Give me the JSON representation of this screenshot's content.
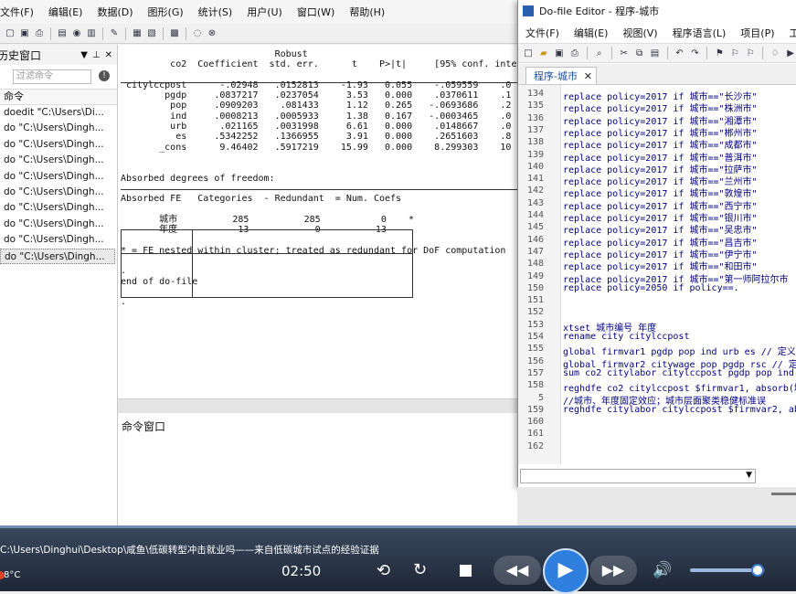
{
  "stata": {
    "menu": [
      "文件(F)",
      "编辑(E)",
      "数据(D)",
      "图形(G)",
      "统计(S)",
      "用户(U)",
      "窗口(W)",
      "帮助(H)"
    ],
    "history": {
      "title": "历史窗口",
      "filter_placeholder": "过滤命令",
      "column": "命令",
      "items": [
        "doedit \"C:\\Users\\Di...",
        "do \"C:\\Users\\Dingh...",
        "do \"C:\\Users\\Dingh...",
        "do \"C:\\Users\\Dingh...",
        "do \"C:\\Users\\Dingh...",
        "do \"C:\\Users\\Dingh...",
        "do \"C:\\Users\\Dingh...",
        "do \"C:\\Users\\Dingh...",
        "do \"C:\\Users\\Dingh...",
        "do \"C:\\Users\\Dingh..."
      ]
    },
    "results_text": "                            Robust\n         co2  Coefficient  std. err.      t    P>|t|     [95% conf. inte\n\n citylccpost      -.02948   .0152813    -1.93   0.055    -.059559    .0\n        pgdp     .0837217   .0237054     3.53   0.000    .0370611    .1\n         pop     .0909203    .081433     1.12   0.265   -.0693686    .2\n         ind     .0008213   .0005933     1.38   0.167   -.0003465    .0\n         urb      .021165   .0031998     6.61   0.000    .0148667    .0\n          es     .5342252   .1366955     3.91   0.000    .2651603    .8\n       _cons      9.46402   .5917219    15.99   0.000    8.299303    10\n\n\nAbsorbed degrees of freedom:\n\nAbsorbed FE   Categories  - Redundant  = Num. Coefs\n\n       城市          285          285           0    *\n       年度           13            0          13\n\n* = FE nested within cluster; treated as redundant for DoF computation\n\n.\nend of do-file\n\n.",
    "command_window": "命令窗口"
  },
  "editor": {
    "title": "Do-file Editor - 程序-城市",
    "menu": [
      "文件(F)",
      "编辑(E)",
      "视图(V)",
      "程序语言(L)",
      "项目(P)",
      "工具(T)"
    ],
    "tab": "程序-城市",
    "lines": [
      {
        "n": "134",
        "t": "replace policy=2017 if 城市==\"长沙市\""
      },
      {
        "n": "135",
        "t": "replace policy=2017 if 城市==\"株洲市\""
      },
      {
        "n": "136",
        "t": "replace policy=2017 if 城市==\"湘潭市\""
      },
      {
        "n": "137",
        "t": "replace policy=2017 if 城市==\"郴州市\""
      },
      {
        "n": "138",
        "t": "replace policy=2017 if 城市==\"成都市\""
      },
      {
        "n": "139",
        "t": "replace policy=2017 if 城市==\"普洱市\""
      },
      {
        "n": "140",
        "t": "replace policy=2017 if 城市==\"拉萨市\""
      },
      {
        "n": "141",
        "t": "replace policy=2017 if 城市==\"兰州市\""
      },
      {
        "n": "142",
        "t": "replace policy=2017 if 城市==\"敦煌市\""
      },
      {
        "n": "143",
        "t": "replace policy=2017 if 城市==\"西宁市\""
      },
      {
        "n": "144",
        "t": "replace policy=2017 if 城市==\"银川市\""
      },
      {
        "n": "145",
        "t": "replace policy=2017 if 城市==\"吴忠市\""
      },
      {
        "n": "146",
        "t": "replace policy=2017 if 城市==\"昌吉市\""
      },
      {
        "n": "147",
        "t": "replace policy=2017 if 城市==\"伊宁市\""
      },
      {
        "n": "148",
        "t": "replace policy=2017 if 城市==\"和田市\""
      },
      {
        "n": "149",
        "t": "replace policy=2017 if 城市==\"第一师阿拉尔市"
      },
      {
        "n": "150",
        "t": "replace policy=2050 if policy==."
      },
      {
        "n": "151",
        "t": ""
      },
      {
        "n": "152",
        "t": ""
      },
      {
        "n": "153",
        "t": "xtset 城市编号 年度"
      },
      {
        "n": "154",
        "t": "rename city citylccpost"
      },
      {
        "n": "155",
        "t": "global firmvar1 pgdp pop ind urb es // 定义"
      },
      {
        "n": "156",
        "t": "global firmvar2 citywage pop pgdp rsc // 定"
      },
      {
        "n": "157",
        "t": "sum co2 citylabor citylccpost pgdp pop ind"
      },
      {
        "n": "158",
        "t": "reghdfe co2 citylccpost $firmvar1, absorb(城"
      },
      {
        "n": "5",
        "t": "//城市、年度固定效应；城市层面聚类稳健标准误"
      },
      {
        "n": "159",
        "t": "reghdfe citylabor citylccpost $firmvar2, ab"
      },
      {
        "n": "160",
        "t": ""
      },
      {
        "n": "161",
        "t": ""
      },
      {
        "n": "162",
        "t": ""
      }
    ]
  },
  "player": {
    "path": "C:\\Users\\Dinghui\\Desktop\\咸鱼\\低碳转型冲击就业吗——来自低碳城市试点的经验证据",
    "time": "02:50",
    "temperature": "8°C",
    "volume": 0.85
  }
}
